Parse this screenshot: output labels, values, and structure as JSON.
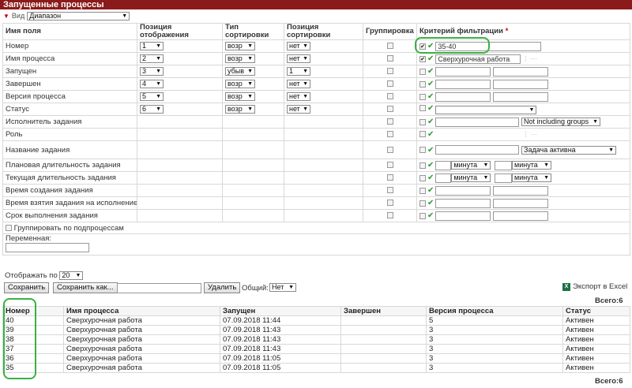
{
  "title": "Запущенные процессы",
  "view": {
    "label": "Вид",
    "value": "Диапазон"
  },
  "headers": {
    "field": "Имя поля",
    "position": "Позиция отображения",
    "sort_type": "Тип сортировки",
    "sort_position": "Позиция сортировки",
    "grouping": "Группировка",
    "filter": "Критерий фильтрации",
    "required_mark": "*"
  },
  "rows": [
    {
      "name": "Номер",
      "pos": "1",
      "sort": "возр",
      "spos": "нет",
      "filter_checked": true,
      "filter_value": "35-40"
    },
    {
      "name": "Имя процесса",
      "pos": "2",
      "sort": "возр",
      "spos": "нет",
      "filter_checked": true,
      "filter_value": "Сверхурочная работа"
    },
    {
      "name": "Запущен",
      "pos": "3",
      "sort": "убыв",
      "spos": "1"
    },
    {
      "name": "Завершен",
      "pos": "4",
      "sort": "возр",
      "spos": "нет"
    },
    {
      "name": "Версия процесса",
      "pos": "5",
      "sort": "возр",
      "spos": "нет"
    },
    {
      "name": "Статус",
      "pos": "6",
      "sort": "возр",
      "spos": "нет"
    },
    {
      "name": "Исполнитель задания",
      "filter_select": "Not including groups"
    },
    {
      "name": "Роль"
    },
    {
      "name": "Название задания",
      "filter_select": "Задача активна"
    },
    {
      "name": "Плановая длительность задания",
      "unit1": "минута",
      "unit2": "минута"
    },
    {
      "name": "Текущая длительность задания",
      "unit1": "минута",
      "unit2": "минута"
    },
    {
      "name": "Время создания задания"
    },
    {
      "name": "Время взятия задания на исполнение"
    },
    {
      "name": "Срок выполнения задания"
    }
  ],
  "group_by_subprocess": "Группировать по подпроцессам",
  "variable_label": "Переменная:",
  "page_size": {
    "label": "Отображать по",
    "value": "20"
  },
  "toolbar": {
    "save": "Сохранить",
    "save_as": "Сохранить как...",
    "delete": "Удалить",
    "shared_label": "Общий:",
    "shared_value": "Нет",
    "export": "Экспорт в Excel"
  },
  "total": "Всего:6",
  "results": {
    "columns": [
      "Номер",
      "Имя процесса",
      "Запущен",
      "Завершен",
      "Версия процесса",
      "Статус"
    ],
    "rows": [
      [
        "40",
        "Сверхурочная работа",
        "07.09.2018 11:44",
        "",
        "5",
        "Активен"
      ],
      [
        "39",
        "Сверхурочная работа",
        "07.09.2018 11:43",
        "",
        "3",
        "Активен"
      ],
      [
        "38",
        "Сверхурочная работа",
        "07.09.2018 11:43",
        "",
        "3",
        "Активен"
      ],
      [
        "37",
        "Сверхурочная работа",
        "07.09.2018 11:43",
        "",
        "3",
        "Активен"
      ],
      [
        "36",
        "Сверхурочная работа",
        "07.09.2018 11:05",
        "",
        "3",
        "Активен"
      ],
      [
        "35",
        "Сверхурочная работа",
        "07.09.2018 11:05",
        "",
        "3",
        "Активен"
      ]
    ]
  },
  "colors": {
    "title_bar": "#8b1a1a",
    "highlight": "#3cb043",
    "check": "#2a9a2a"
  }
}
